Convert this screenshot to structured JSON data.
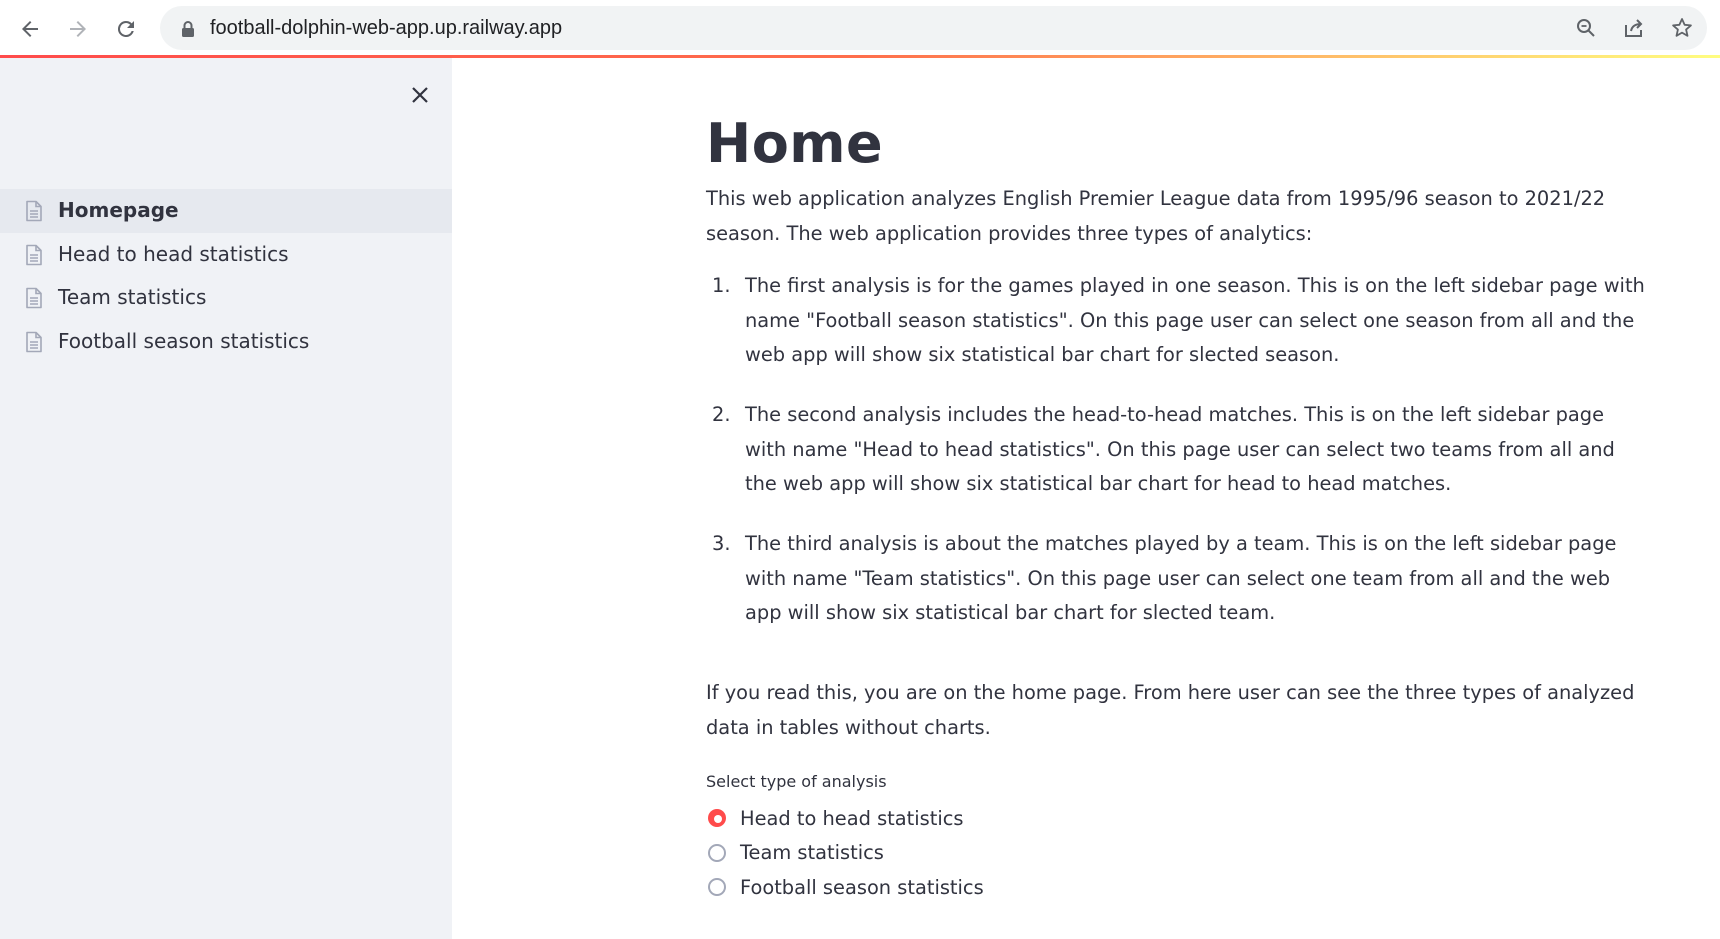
{
  "browser": {
    "url": "football-dolphin-web-app.up.railway.app",
    "icons": {
      "back": "arrow-left-icon",
      "forward": "arrow-right-icon",
      "reload": "reload-icon",
      "lock": "lock-icon",
      "zoom": "zoom-icon",
      "share": "share-icon",
      "bookmark": "star-icon"
    }
  },
  "sidebar": {
    "close_icon": "close-icon",
    "items": [
      {
        "label": "Homepage",
        "active": true
      },
      {
        "label": "Head to head statistics",
        "active": false
      },
      {
        "label": "Team statistics",
        "active": false
      },
      {
        "label": "Football season statistics",
        "active": false
      }
    ]
  },
  "main": {
    "title": "Home",
    "intro": "This web application analyzes English Premier League data from 1995/96 season to 2021/22 season. The web application provides three types of analytics:",
    "list": [
      {
        "num": "1.",
        "text": "The first analysis is for the games played in one season. This is on the left sidebar page with name \"Football season statistics\". On this page user can select one season from all and the web app will show six statistical bar chart for slected season."
      },
      {
        "num": "2.",
        "text": "The second analysis includes the head-to-head matches. This is on the left sidebar page with name \"Head to head statistics\". On this page user can select two teams from all and the web app will show six statistical bar chart for head to head matches."
      },
      {
        "num": "3.",
        "text": "The third analysis is about the matches played by a team. This is on the left sidebar page with name \"Team statistics\". On this page user can select one team from all and the web app will show six statistical bar chart for slected team."
      }
    ],
    "outro": "If you read this, you are on the home page. From here user can see the three types of analyzed data in tables without charts.",
    "radio": {
      "label": "Select type of analysis",
      "options": [
        {
          "label": "Head to head statistics",
          "checked": true
        },
        {
          "label": "Team statistics",
          "checked": false
        },
        {
          "label": "Football season statistics",
          "checked": false
        }
      ]
    }
  },
  "colors": {
    "accent": "#ff4b4b",
    "sidebar_bg": "#f0f2f6",
    "text": "#31333f"
  }
}
